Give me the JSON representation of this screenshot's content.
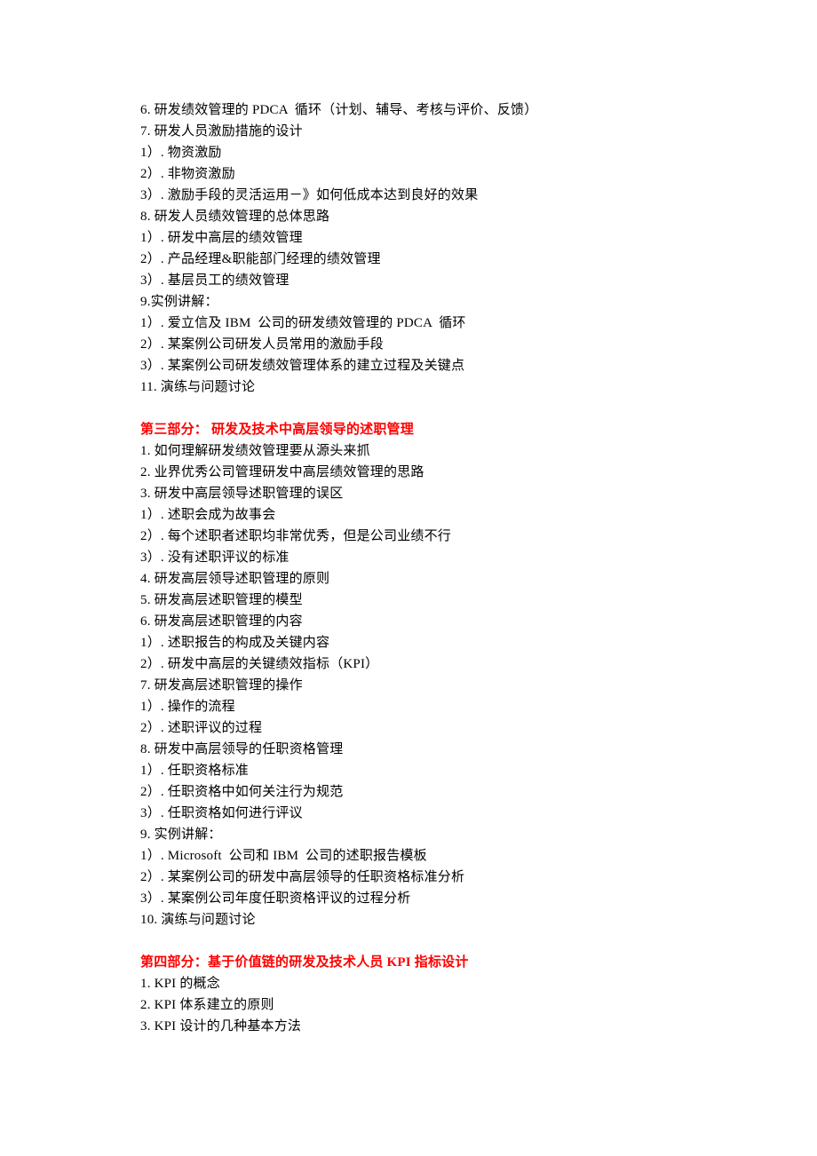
{
  "block1": {
    "lines": [
      "6. 研发绩效管理的 PDCA  循环（计划、辅导、考核与评价、反馈）",
      "7. 研发人员激励措施的设计",
      "1）. 物资激励",
      "2）. 非物资激励",
      "3）. 激励手段的灵活运用－》如何低成本达到良好的效果",
      "8. 研发人员绩效管理的总体思路",
      "1）. 研发中高层的绩效管理",
      "2）. 产品经理&职能部门经理的绩效管理",
      "3）. 基层员工的绩效管理",
      "9.实例讲解：",
      "1）. 爱立信及 IBM  公司的研发绩效管理的 PDCA  循环",
      "2）. 某案例公司研发人员常用的激励手段",
      "3）. 某案例公司研发绩效管理体系的建立过程及关键点",
      "11. 演练与问题讨论"
    ]
  },
  "section3": {
    "heading": "第三部分：  研发及技术中高层领导的述职管理",
    "lines": [
      "1. 如何理解研发绩效管理要从源头来抓",
      "2. 业界优秀公司管理研发中高层绩效管理的思路",
      "3. 研发中高层领导述职管理的误区",
      "1）. 述职会成为故事会",
      "2）. 每个述职者述职均非常优秀，但是公司业绩不行",
      "3）. 没有述职评议的标准",
      "4. 研发高层领导述职管理的原则",
      "5. 研发高层述职管理的模型",
      "6. 研发高层述职管理的内容",
      "1）. 述职报告的构成及关键内容",
      "2）. 研发中高层的关键绩效指标（KPI）",
      "7. 研发高层述职管理的操作",
      "1）. 操作的流程",
      "2）. 述职评议的过程",
      "8. 研发中高层领导的任职资格管理",
      "1）. 任职资格标准",
      "2）. 任职资格中如何关注行为规范",
      "3）. 任职资格如何进行评议",
      "9. 实例讲解：",
      "1）. Microsoft  公司和 IBM  公司的述职报告模板",
      "2）. 某案例公司的研发中高层领导的任职资格标准分析",
      "3）. 某案例公司年度任职资格评议的过程分析",
      "10. 演练与问题讨论"
    ]
  },
  "section4": {
    "heading": "第四部分：基于价值链的研发及技术人员 KPI 指标设计",
    "lines": [
      "1. KPI 的概念",
      "2. KPI 体系建立的原则",
      "3. KPI 设计的几种基本方法"
    ]
  }
}
